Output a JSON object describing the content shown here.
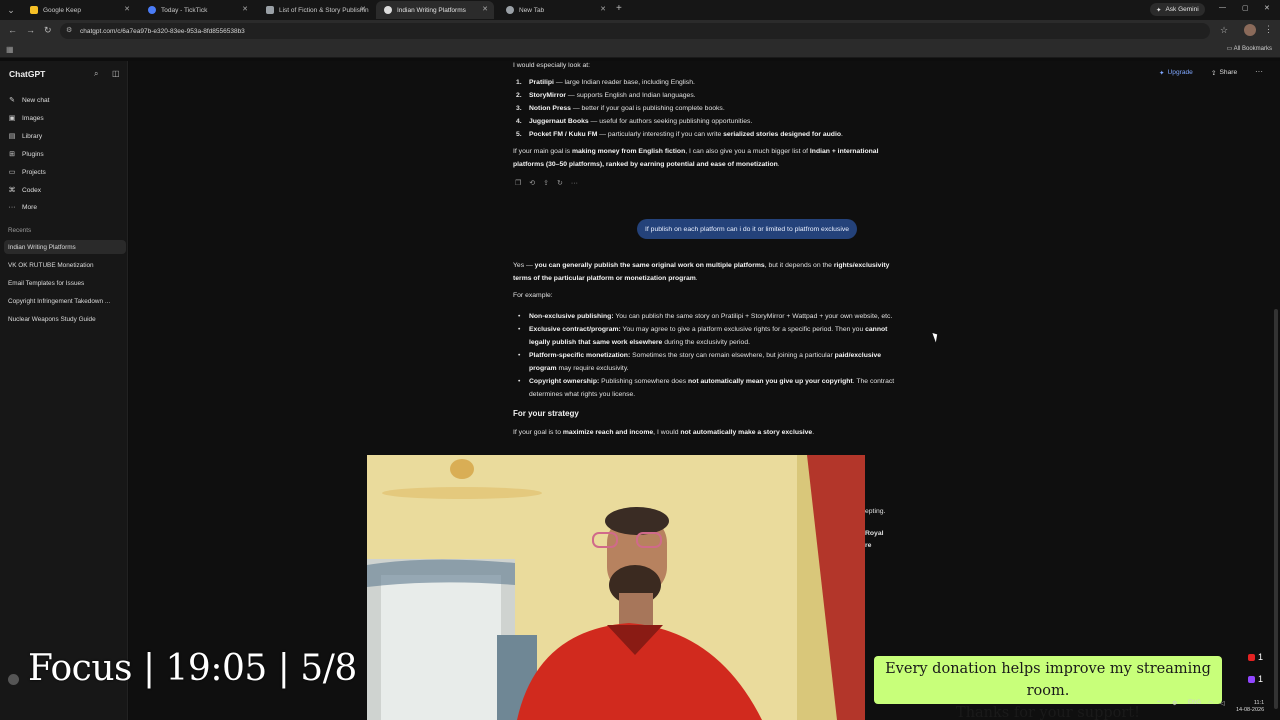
{
  "browser": {
    "tabs": [
      {
        "title": "Google Keep",
        "fav_color": "#f6c026"
      },
      {
        "title": "Today - TickTick",
        "fav_color": "#4a7cf7"
      },
      {
        "title": "List of Fiction & Story Publishin",
        "fav_color": "#9aa0a6"
      },
      {
        "title": "Indian Writing Platforms",
        "fav_color": "#dcdcdc",
        "active": true
      },
      {
        "title": "New Tab",
        "fav_color": "#9aa0a6"
      }
    ],
    "ask_gemini": "Ask Gemini",
    "url": "chatgpt.com/c/6a7ea97b-e320-83ee-953a-8fd8556538b3",
    "all_bookmarks": "All Bookmarks"
  },
  "sidebar": {
    "brand": "ChatGPT",
    "nav": [
      {
        "label": "New chat",
        "icon": "pencil-icon"
      },
      {
        "label": "Images",
        "icon": "image-icon"
      },
      {
        "label": "Library",
        "icon": "library-icon"
      },
      {
        "label": "Plugins",
        "icon": "plugins-icon"
      },
      {
        "label": "Projects",
        "icon": "folder-icon"
      },
      {
        "label": "Codex",
        "icon": "codex-icon"
      },
      {
        "label": "More",
        "icon": "dots-icon"
      }
    ],
    "recents_label": "Recents",
    "recents": [
      "Indian Writing Platforms",
      "VK OK RUTUBE Monetization",
      "Email Templates for Issues",
      "Copyright Infringement Takedown ...",
      "Nuclear Weapons Study Guide"
    ]
  },
  "header": {
    "upgrade": "Upgrade",
    "share": "Share"
  },
  "conversation": {
    "intro": "I would especially look at:",
    "platforms": [
      {
        "n": "1.",
        "name": "Pratilipi",
        "desc": " — large Indian reader base, including English."
      },
      {
        "n": "2.",
        "name": "StoryMirror",
        "desc": " — supports English and Indian languages."
      },
      {
        "n": "3.",
        "name": "Notion Press",
        "desc": " — better if your goal is publishing complete books."
      },
      {
        "n": "4.",
        "name": "Juggernaut Books",
        "desc": " — useful for authors seeking publishing opportunities."
      },
      {
        "n": "5.",
        "name": "Pocket FM / Kuku FM",
        "desc": " — particularly interesting if you can write ",
        "bold2": "serialized stories designed for audio",
        "tail": "."
      }
    ],
    "goal_a": "If your main goal is ",
    "goal_b": "making money from English fiction",
    "goal_c": ", I can also give you a much bigger list of ",
    "goal_d": "Indian + international platforms (30–50 platforms), ranked by earning potential and ease of monetization",
    "goal_e": ".",
    "user_message": "If publish on each platform can i do it or limited to platfrom exclusive",
    "ans_a": "Yes — ",
    "ans_b": "you can generally publish the same original work on multiple platforms",
    "ans_c": ", but it depends on the ",
    "ans_d": "rights/exclusivity terms of the particular platform or monetization program",
    "ans_e": ".",
    "example_label": "For example:",
    "bullets": [
      {
        "b": "Non-exclusive publishing:",
        "t": " You can publish the same story on Pratilipi + StoryMirror + Wattpad + your own website, etc."
      },
      {
        "b": "Exclusive contract/program:",
        "t": " You may agree to give a platform exclusive rights for a specific period. Then you ",
        "b2": "cannot legally publish that same work elsewhere",
        "t2": " during the exclusivity period."
      },
      {
        "b": "Platform-specific monetization:",
        "t": " Sometimes the story can remain elsewhere, but joining a particular ",
        "b2": "paid/exclusive program",
        "t2": " may require exclusivity."
      },
      {
        "b": "Copyright ownership:",
        "t": " Publishing somewhere does ",
        "b2": "not automatically mean you give up your copyright",
        "t2": ". The contract determines what rights you license."
      }
    ],
    "strategy_heading": "For your strategy",
    "strat_a": "If your goal is to ",
    "strat_b": "maximize reach and income",
    "strat_c": ", I would ",
    "strat_d": "not automatically make a story exclusive",
    "strat_e": ".",
    "peek_1": "epting.",
    "peek_2": "Royal",
    "peek_3": "re"
  },
  "overlays": {
    "focus": "Focus | 19:05 | 5/8",
    "donation_line1": "Every donation helps improve my streaming room.",
    "donation_line2": "Thanks for your support!",
    "notif_youtube": "1",
    "notif_twitch": "1"
  },
  "taskbar": {
    "lang": "ENG",
    "time": "11:1",
    "date": "14-08-2026"
  },
  "colors": {
    "accent": "#24427a",
    "donation_bg": "#c8ff7a",
    "upgrade": "#7fa7ff"
  }
}
